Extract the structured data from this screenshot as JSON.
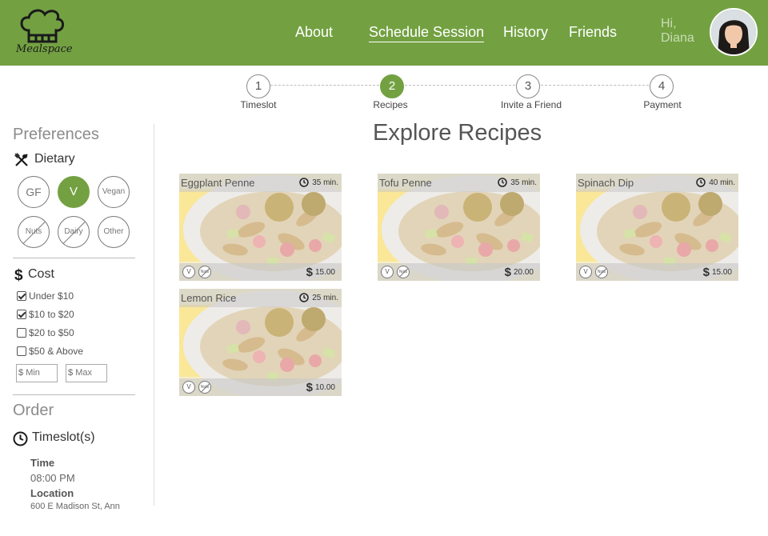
{
  "app": {
    "logo_text": "Mealspace"
  },
  "header": {
    "nav": [
      {
        "label": "About",
        "active": false
      },
      {
        "label": "Schedule Session",
        "active": true
      },
      {
        "label": "History",
        "active": false
      },
      {
        "label": "Friends",
        "active": false
      }
    ],
    "greeting_line1": "Hi,",
    "greeting_line2": "Diana",
    "brand_color": "#73a142"
  },
  "stepper": {
    "steps": [
      {
        "number": "1",
        "label": "Timeslot",
        "active": false
      },
      {
        "number": "2",
        "label": "Recipes",
        "active": true
      },
      {
        "number": "3",
        "label": "Invite a Friend",
        "active": false
      },
      {
        "number": "4",
        "label": "Payment",
        "active": false
      }
    ]
  },
  "sidebar": {
    "preferences_title": "Preferences",
    "dietary_title": "Dietary",
    "dietary_options": [
      {
        "label": "GF",
        "selected": false,
        "excluded": false
      },
      {
        "label": "V",
        "selected": true,
        "excluded": false
      },
      {
        "label": "Vegan",
        "selected": false,
        "excluded": false
      },
      {
        "label": "Nuts",
        "selected": false,
        "excluded": true
      },
      {
        "label": "Dairy",
        "selected": false,
        "excluded": true
      },
      {
        "label": "Other",
        "selected": false,
        "excluded": false
      }
    ],
    "cost_title": "Cost",
    "cost_options": [
      {
        "label": "Under $10",
        "checked": true
      },
      {
        "label": "$10 to $20",
        "checked": true
      },
      {
        "label": "$20 to $50",
        "checked": false
      },
      {
        "label": "$50 & Above",
        "checked": false
      }
    ],
    "min_placeholder": "Min",
    "max_placeholder": "Max",
    "currency_symbol": "$",
    "order_title": "Order",
    "timeslot_title": "Timeslot(s)",
    "time_label": "Time",
    "time_value": "08:00 PM",
    "location_label": "Location",
    "location_value": "600 E Madison St, Ann"
  },
  "main": {
    "title": "Explore Recipes",
    "recipes": [
      {
        "name": "Eggplant Penne",
        "time": "35 min.",
        "price": "15.00",
        "tags": [
          "V",
          "Nuts"
        ]
      },
      {
        "name": "Tofu Penne",
        "time": "35 min.",
        "price": "20.00",
        "tags": [
          "V",
          "Nuts"
        ]
      },
      {
        "name": "Spinach Dip",
        "time": "40 min.",
        "price": "15.00",
        "tags": [
          "V",
          "Nuts"
        ]
      },
      {
        "name": "Lemon Rice",
        "time": "25 min.",
        "price": "10.00",
        "tags": [
          "V",
          "Nuts"
        ]
      }
    ]
  }
}
